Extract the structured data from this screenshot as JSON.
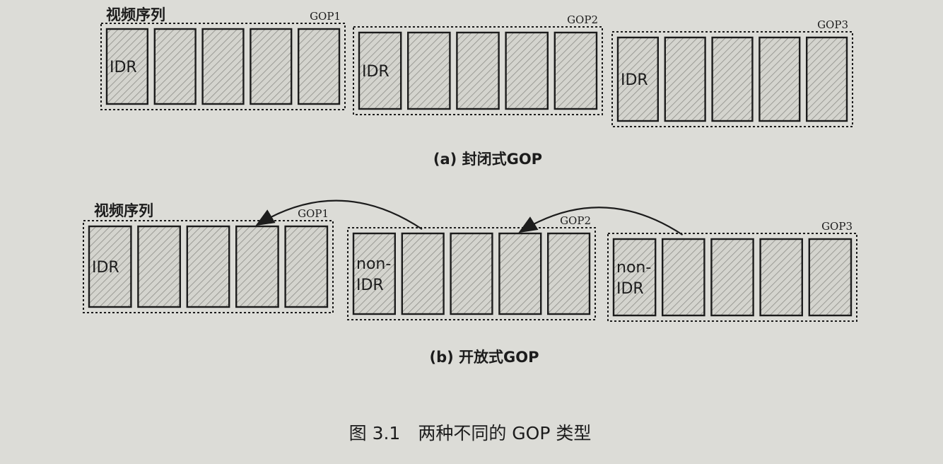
{
  "figure": {
    "title": "图 3.1　两种不同的 GOP 类型",
    "colors": {
      "paper": "#dcdcd7",
      "ink": "#1c1c1c",
      "hatch": "#8d8d88",
      "frame_fill": "#d4d4ce"
    }
  },
  "panels": [
    {
      "id": "a",
      "sequence_label": "视频序列",
      "caption": "(a) 封闭式GOP",
      "type": "closed",
      "gops": [
        {
          "label": "GOP1",
          "first_frame_label": [
            "IDR"
          ],
          "frame_count": 5
        },
        {
          "label": "GOP2",
          "first_frame_label": [
            "IDR"
          ],
          "frame_count": 5
        },
        {
          "label": "GOP3",
          "first_frame_label": [
            "IDR"
          ],
          "frame_count": 5
        }
      ]
    },
    {
      "id": "b",
      "sequence_label": "视频序列",
      "caption": "(b) 开放式GOP",
      "type": "open",
      "gops": [
        {
          "label": "GOP1",
          "first_frame_label": [
            "IDR"
          ],
          "frame_count": 5
        },
        {
          "label": "GOP2",
          "first_frame_label": [
            "non-",
            "IDR"
          ],
          "frame_count": 5
        },
        {
          "label": "GOP3",
          "first_frame_label": [
            "non-",
            "IDR"
          ],
          "frame_count": 5
        }
      ],
      "references": [
        {
          "from_gop": 2,
          "to_gop": 1
        },
        {
          "from_gop": 3,
          "to_gop": 2
        }
      ]
    }
  ]
}
